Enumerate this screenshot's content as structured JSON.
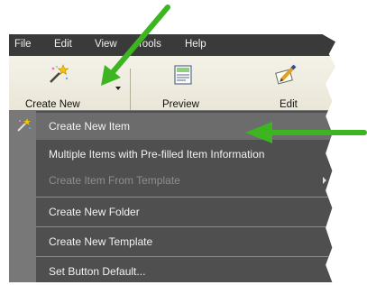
{
  "menubar": {
    "items": [
      {
        "label": "File"
      },
      {
        "label": "Edit"
      },
      {
        "label": "View"
      },
      {
        "label": "Tools"
      },
      {
        "label": "Help"
      }
    ]
  },
  "toolbar": {
    "create_new_label": "Create New",
    "preview_label": "Preview",
    "edit_label": "Edit"
  },
  "menu": {
    "items": [
      {
        "label": "Create New Item",
        "state": "highlighted",
        "icon": "magic-wand-icon"
      },
      {
        "label": "Multiple Items with Pre-filled Item Information",
        "state": "enabled"
      },
      {
        "label": "Create Item From Template",
        "state": "disabled",
        "has_submenu": true
      },
      {
        "label": "Create New Folder",
        "state": "enabled"
      },
      {
        "label": "Create New Template",
        "state": "enabled"
      },
      {
        "label": "Set Button Default...",
        "state": "enabled"
      }
    ]
  },
  "annotations": {
    "arrow_color": "#3cb521",
    "arrows": [
      "arrow-to-create-new-button",
      "arrow-to-create-new-item"
    ]
  },
  "colors": {
    "menu_bg": "#4f4f4f",
    "menu_gutter": "#787878",
    "menu_highlight": "#6c6c6c",
    "menubar_bg": "#3a3a3a",
    "toolbar_bg": "#ece9d8"
  }
}
